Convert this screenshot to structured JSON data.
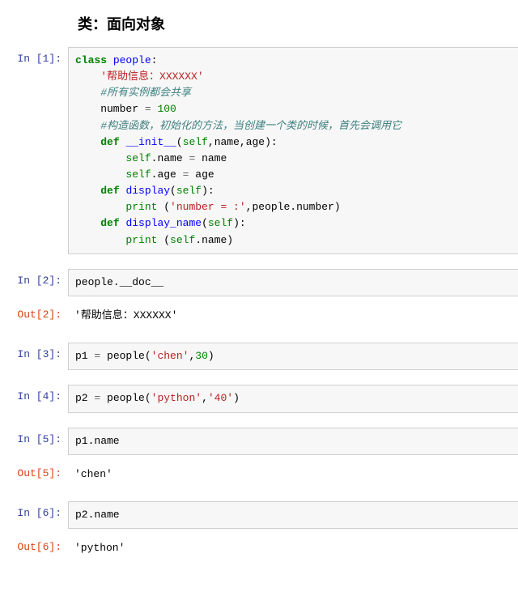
{
  "heading": "类：面向对象",
  "cells": [
    {
      "prompt_in": "In  [1]:",
      "code_tokens": [
        [
          "kw",
          "class"
        ],
        [
          "txt",
          " "
        ],
        [
          "cls",
          "people"
        ],
        [
          "txt",
          ":"
        ],
        [
          "br",
          ""
        ],
        [
          "txt",
          "    "
        ],
        [
          "str",
          "'帮助信息：XXXXXX'"
        ],
        [
          "br",
          ""
        ],
        [
          "txt",
          "    "
        ],
        [
          "com",
          "#所有实例都会共享"
        ],
        [
          "br",
          ""
        ],
        [
          "txt",
          "    number "
        ],
        [
          "op",
          "="
        ],
        [
          "txt",
          " "
        ],
        [
          "num",
          "100"
        ],
        [
          "br",
          ""
        ],
        [
          "txt",
          "    "
        ],
        [
          "com",
          "#构造函数，初始化的方法，当创建一个类的时候，首先会调用它"
        ],
        [
          "br",
          ""
        ],
        [
          "txt",
          "    "
        ],
        [
          "kw",
          "def"
        ],
        [
          "txt",
          " "
        ],
        [
          "cls",
          "__init__"
        ],
        [
          "txt",
          "("
        ],
        [
          "builtin",
          "self"
        ],
        [
          "txt",
          ",name,age):"
        ],
        [
          "br",
          ""
        ],
        [
          "txt",
          "        "
        ],
        [
          "builtin",
          "self"
        ],
        [
          "txt",
          ".name "
        ],
        [
          "op",
          "="
        ],
        [
          "txt",
          " name"
        ],
        [
          "br",
          ""
        ],
        [
          "txt",
          "        "
        ],
        [
          "builtin",
          "self"
        ],
        [
          "txt",
          ".age "
        ],
        [
          "op",
          "="
        ],
        [
          "txt",
          " age"
        ],
        [
          "br",
          ""
        ],
        [
          "txt",
          "    "
        ],
        [
          "kw",
          "def"
        ],
        [
          "txt",
          " "
        ],
        [
          "cls",
          "display"
        ],
        [
          "txt",
          "("
        ],
        [
          "builtin",
          "self"
        ],
        [
          "txt",
          "):"
        ],
        [
          "br",
          ""
        ],
        [
          "txt",
          "        "
        ],
        [
          "builtin",
          "print"
        ],
        [
          "txt",
          " ("
        ],
        [
          "str",
          "'number = :'"
        ],
        [
          "txt",
          ",people.number)"
        ],
        [
          "br",
          ""
        ],
        [
          "txt",
          "    "
        ],
        [
          "kw",
          "def"
        ],
        [
          "txt",
          " "
        ],
        [
          "cls",
          "display_name"
        ],
        [
          "txt",
          "("
        ],
        [
          "builtin",
          "self"
        ],
        [
          "txt",
          "):"
        ],
        [
          "br",
          ""
        ],
        [
          "txt",
          "        "
        ],
        [
          "builtin",
          "print"
        ],
        [
          "txt",
          " ("
        ],
        [
          "builtin",
          "self"
        ],
        [
          "txt",
          ".name)"
        ]
      ]
    },
    {
      "prompt_in": "In  [2]:",
      "code_tokens": [
        [
          "txt",
          "people.__doc__"
        ]
      ],
      "prompt_out": "Out[2]:",
      "output": "'帮助信息：XXXXXX'"
    },
    {
      "prompt_in": "In  [3]:",
      "code_tokens": [
        [
          "txt",
          "p1 "
        ],
        [
          "op",
          "="
        ],
        [
          "txt",
          " people("
        ],
        [
          "str",
          "'chen'"
        ],
        [
          "txt",
          ","
        ],
        [
          "num",
          "30"
        ],
        [
          "txt",
          ")"
        ]
      ]
    },
    {
      "prompt_in": "In  [4]:",
      "code_tokens": [
        [
          "txt",
          "p2 "
        ],
        [
          "op",
          "="
        ],
        [
          "txt",
          " people("
        ],
        [
          "str",
          "'python'"
        ],
        [
          "txt",
          ","
        ],
        [
          "str",
          "'40'"
        ],
        [
          "txt",
          ")"
        ]
      ]
    },
    {
      "prompt_in": "In  [5]:",
      "code_tokens": [
        [
          "txt",
          "p1.name"
        ]
      ],
      "prompt_out": "Out[5]:",
      "output": "'chen'"
    },
    {
      "prompt_in": "In  [6]:",
      "code_tokens": [
        [
          "txt",
          "p2.name"
        ]
      ],
      "prompt_out": "Out[6]:",
      "output": "'python'"
    }
  ]
}
